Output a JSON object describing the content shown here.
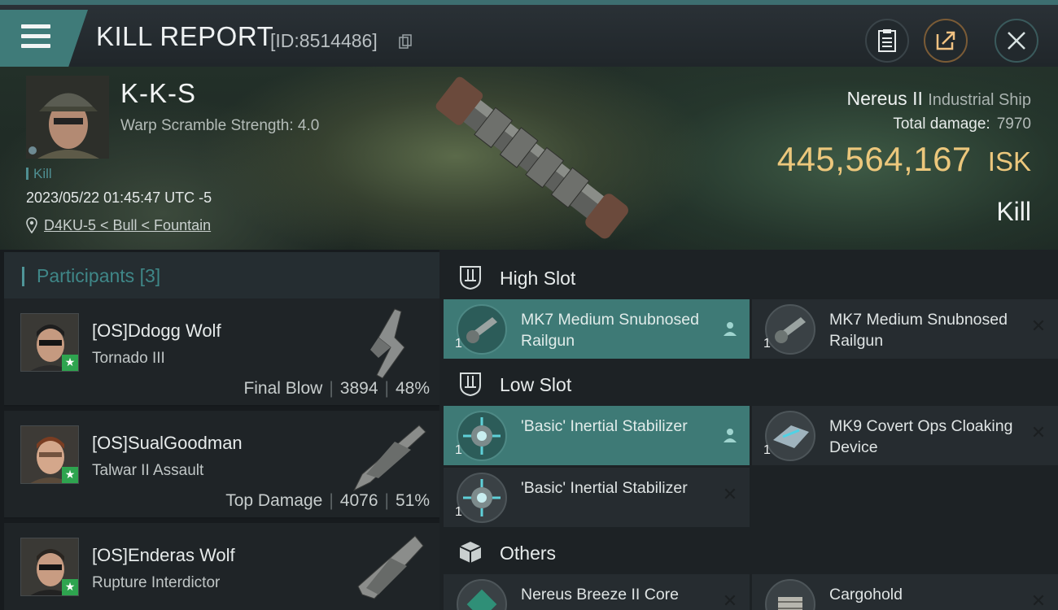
{
  "header": {
    "title": "KILL REPORT",
    "report_id": "[ID:8514486]"
  },
  "victim": {
    "name": "K-K-S",
    "warp_scramble": "Warp Scramble Strength: 4.0",
    "tag": "Kill",
    "datetime": "2023/05/22 01:45:47 UTC -5",
    "location": "D4KU-5 < Bull < Fountain",
    "ship_name": "Nereus II",
    "ship_class": "Industrial Ship",
    "total_damage_label": "Total damage:",
    "total_damage": "7970",
    "isk_value": "445,564,167",
    "isk_unit": "ISK",
    "result": "Kill"
  },
  "participants": {
    "title": "Participants",
    "count": "[3]",
    "list": [
      {
        "name": "[OS]Ddogg Wolf",
        "ship": "Tornado III",
        "role": "Final Blow",
        "damage": "3894",
        "percent": "48%"
      },
      {
        "name": "[OS]SualGoodman",
        "ship": "Talwar II Assault",
        "role": "Top Damage",
        "damage": "4076",
        "percent": "51%"
      },
      {
        "name": "[OS]Enderas Wolf",
        "ship": "Rupture Interdictor",
        "role": "",
        "damage": "",
        "percent": ""
      }
    ]
  },
  "fitting": {
    "high_slot": {
      "label": "High Slot",
      "modules": [
        {
          "name": "MK7 Medium Snubnosed Railgun",
          "qty": "1",
          "status": "fitted"
        },
        {
          "name": "MK7 Medium Snubnosed Railgun",
          "qty": "1",
          "status": "destroyed"
        }
      ]
    },
    "low_slot": {
      "label": "Low Slot",
      "modules": [
        {
          "name": "'Basic' Inertial Stabilizer",
          "qty": "1",
          "status": "fitted"
        },
        {
          "name": "MK9 Covert Ops Cloaking Device",
          "qty": "1",
          "status": "destroyed"
        },
        {
          "name": "'Basic' Inertial Stabilizer",
          "qty": "1",
          "status": "destroyed"
        }
      ]
    },
    "others": {
      "label": "Others",
      "modules": [
        {
          "name": "Nereus Breeze II Core",
          "qty": "",
          "status": "destroyed"
        },
        {
          "name": "Cargohold",
          "qty": "",
          "status": "destroyed"
        }
      ]
    }
  },
  "colors": {
    "accent": "#3f7b79",
    "isk": "#ecc77c",
    "active_module": "#3e7a76"
  }
}
